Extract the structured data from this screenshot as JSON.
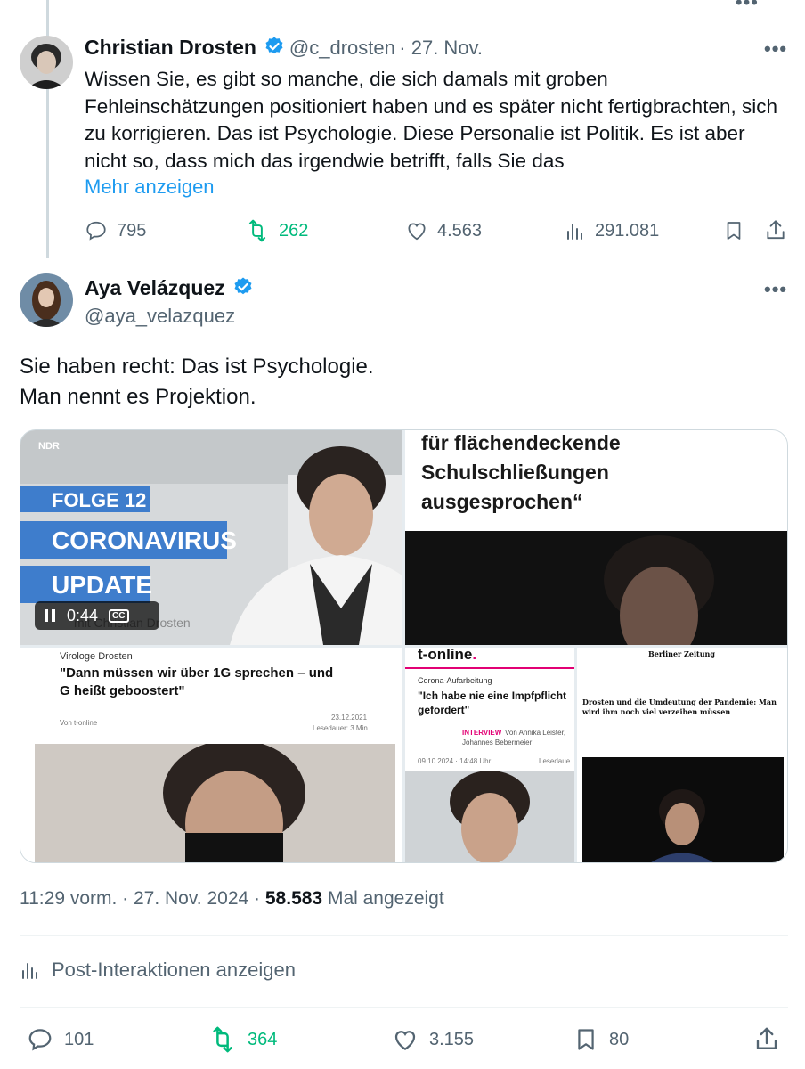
{
  "tweet1": {
    "author_name": "Christian Drosten",
    "handle": "@c_drosten",
    "date": "· 27. Nov.",
    "text": "Wissen Sie, es gibt so manche, die sich damals mit groben Fehleinschätzungen positioniert haben und es später nicht fertigbrachten, sich zu korrigieren. Das ist Psychologie. Diese Personalie ist Politik. Es ist aber nicht so, dass mich das irgendwie betrifft, falls Sie das",
    "show_more": "Mehr anzeigen",
    "replies": "795",
    "retweets": "262",
    "likes": "4.563",
    "views": "291.081"
  },
  "tweet2": {
    "author_name": "Aya Velázquez",
    "handle": "@aya_velazquez",
    "text_line1": "Sie haben recht: Das ist Psychologie.",
    "text_line2": "Man nennt es Projektion.",
    "media": {
      "video": {
        "badge": "NDR",
        "folge": "FOLGE 12",
        "title1": "CORONAVIRUS",
        "title2": "UPDATE",
        "time": "0:44",
        "cc": "CC",
        "caption": "mit Christian Drosten"
      },
      "quote": {
        "line1": "für flächendeckende",
        "line2": "Schulschließungen",
        "line3": "ausgesprochen“"
      },
      "article1": {
        "kicker": "Virologe Drosten",
        "headline1": "\"Dann müssen wir über 1G sprechen – und",
        "headline2": "G heißt geboostert\"",
        "source": "Von t-online",
        "date": "23.12.2021",
        "readtime": "Lesedauer: 3 Min."
      },
      "article2": {
        "logo": "t-online",
        "kicker": "Corona-Aufarbeitung",
        "headline1": "\"Ich habe nie eine Impfpflicht",
        "headline2": "gefordert\"",
        "interview": "INTERVIEW",
        "authors1": "Von Annika Leister,",
        "authors2": "Johannes Bebermeier",
        "date": "09.10.2024 · 14:48 Uhr",
        "readtime": "Lesedaue"
      },
      "article3": {
        "logo": "Berliner Zeitung",
        "headline": "Drosten und die Umdeutung der Pandemie: Man wird ihm noch viel verzeihen müssen"
      }
    },
    "timestamp": "11:29 vorm. · 27. Nov. 2024 ·",
    "views_count": "58.583",
    "views_label": "Mal angezeigt",
    "interactions": "Post-Interaktionen anzeigen",
    "replies": "101",
    "retweets": "364",
    "likes": "3.155",
    "bookmarks": "80"
  },
  "colors": {
    "accent": "#1d9bf0",
    "retweet": "#00ba7c",
    "muted": "#536471",
    "text": "#0f1419"
  }
}
